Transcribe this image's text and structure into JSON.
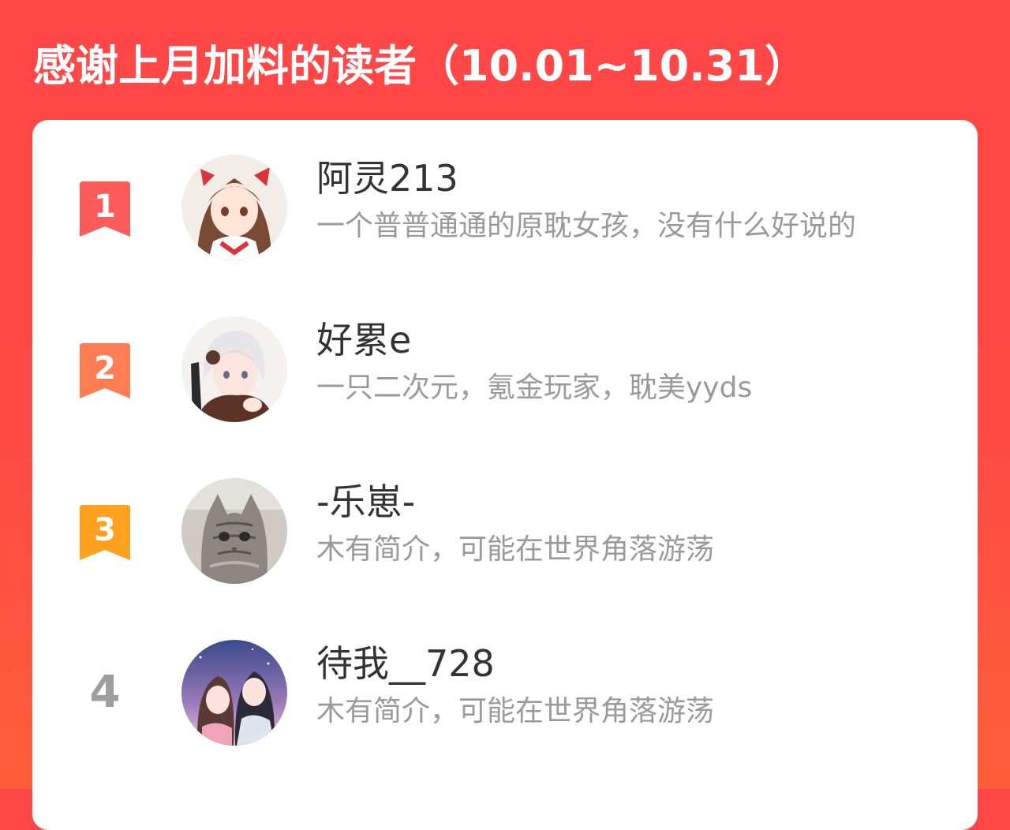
{
  "header": {
    "title": "感谢上月加料的读者（10.01~10.31）"
  },
  "colors": {
    "background": "#ff4747",
    "rank_1": "#ff5b5b",
    "rank_2": "#ff7d52",
    "rank_3": "#ffa01f",
    "rank_other": "#9e9e9e"
  },
  "readers": [
    {
      "rank": "1",
      "name": "阿灵213",
      "bio": "一个普普通通的原耽女孩，没有什么好说的",
      "avatar": "anime-girl-red-ribbons-avatar"
    },
    {
      "rank": "2",
      "name": "好累e",
      "bio": "一只二次元，氪金玩家，耽美yyds",
      "avatar": "anime-boy-white-hair-avatar"
    },
    {
      "rank": "3",
      "name": "-乐崽-",
      "bio": "木有简介，可能在世界角落游荡",
      "avatar": "tabby-cat-avatar"
    },
    {
      "rank": "4",
      "name": "待我__728",
      "bio": "木有简介，可能在世界角落游荡",
      "avatar": "anime-couple-night-sky-avatar"
    }
  ]
}
